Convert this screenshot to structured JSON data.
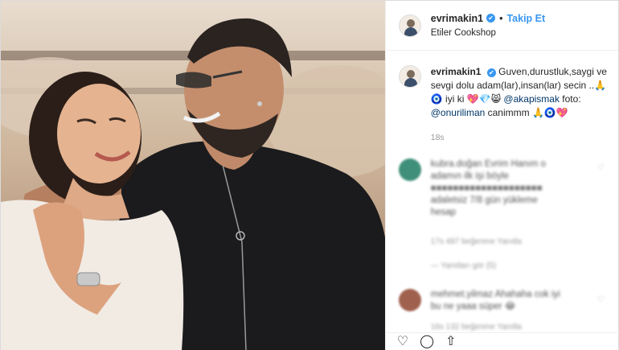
{
  "header": {
    "username": "evrimakin1",
    "verified_icon": "✔",
    "separator": "•",
    "follow_label": "Takip Et",
    "location": "Etiler Cookshop"
  },
  "caption": {
    "username": "evrimakin1",
    "text_1": "Guven,durustluk,saygi ve sevgi dolu adam(lar),insan(lar) secin ..🙏🧿 iyi ki 💖💎😸 ",
    "mention_1": "@akapismak",
    "text_2": " foto: ",
    "mention_2": "@onuriliman",
    "text_3": " canimmm 🙏🧿💖",
    "time": "18s"
  },
  "comments": [
    {
      "avatar_color": "#3f8f7a",
      "lines": [
        "kubra.doğan Evrim Hanım o",
        "adamın ilk işi böyle",
        "■■■■■■■■■■■■■■■■■■■■",
        "adaletsiz 7/8 gün yükleme",
        "hesap"
      ],
      "meta": "17s  487 beğenme  Yanıtla",
      "replies": "— Yanıtları gör (5)"
    },
    {
      "avatar_color": "#a0604e",
      "lines": [
        "mehmet.yilmaz Ahahaha cok iyi",
        "bu ne yaaa süper 😂"
      ],
      "meta": "16s  132 beğenme  Yanıtla"
    }
  ],
  "actions": {
    "like_icon": "♡",
    "comment_icon": "◯",
    "share_icon": "⇧",
    "save_icon": "▢"
  },
  "colors": {
    "accent": "#3897f0",
    "mention": "#003569",
    "muted": "#999999"
  }
}
